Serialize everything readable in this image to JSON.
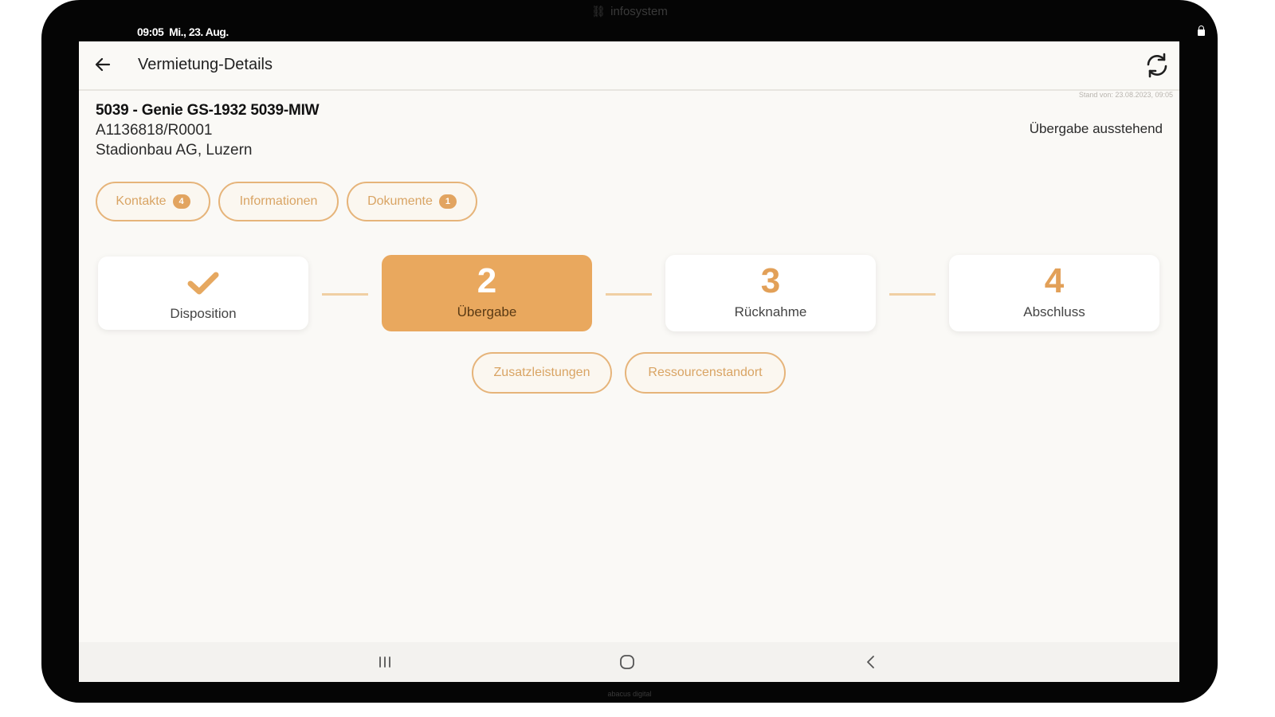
{
  "device": {
    "brand": "infosystem",
    "brand_bottom": "abacus digital"
  },
  "status_bar": {
    "time": "09:05",
    "date": "Mi., 23. Aug."
  },
  "app_bar": {
    "title": "Vermietung-Details"
  },
  "timestamp": "Stand von: 23.08.2023, 09:05",
  "rental": {
    "title": "5039 - Genie GS-1932 5039-MIW",
    "reference": "A1136818/R0001",
    "customer": "Stadionbau AG, Luzern",
    "status": "Übergabe ausstehend"
  },
  "tabs": [
    {
      "label": "Kontakte",
      "badge": "4"
    },
    {
      "label": "Informationen"
    },
    {
      "label": "Dokumente",
      "badge": "1"
    }
  ],
  "steps": [
    {
      "label": "Disposition",
      "state": "done"
    },
    {
      "number": "2",
      "label": "Übergabe",
      "state": "active"
    },
    {
      "number": "3",
      "label": "Rücknahme",
      "state": "pending"
    },
    {
      "number": "4",
      "label": "Abschluss",
      "state": "pending"
    }
  ],
  "actions": [
    {
      "label": "Zusatzleistungen"
    },
    {
      "label": "Ressourcenstandort"
    }
  ],
  "colors": {
    "accent": "#e9a85e",
    "accent_light": "#f0cfa3",
    "background": "#faf9f6",
    "frame": "#050505"
  }
}
